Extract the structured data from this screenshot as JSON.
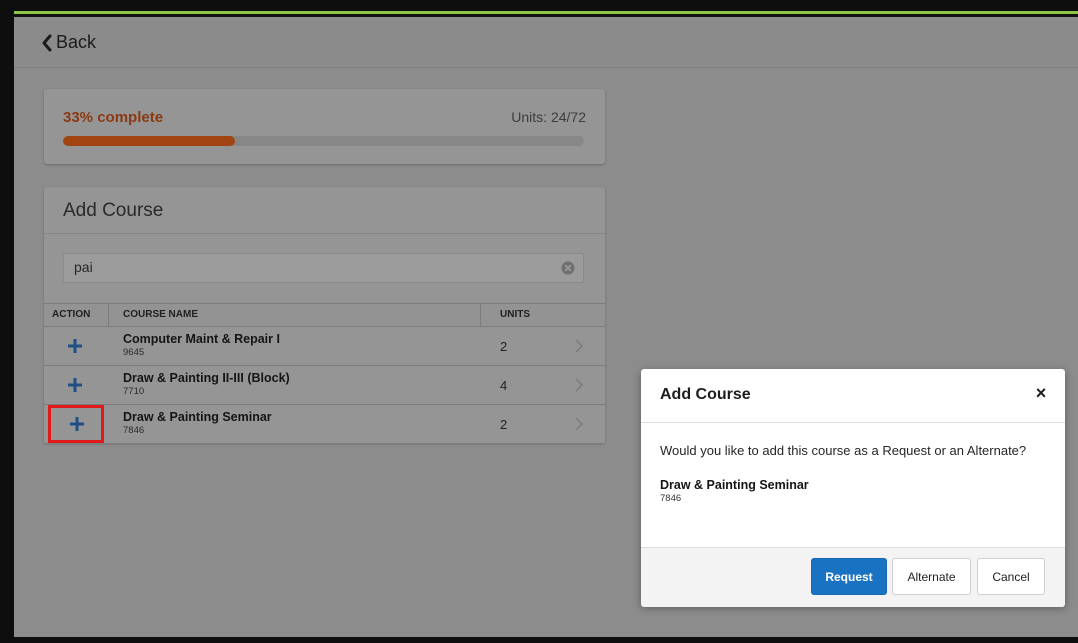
{
  "header": {
    "back_label": "Back"
  },
  "progress": {
    "percent_label": "33% complete",
    "units_label": "Units: 24/72",
    "fraction": 0.33
  },
  "add_course": {
    "title": "Add Course",
    "search_value": "pai",
    "columns": [
      "ACTION",
      "COURSE NAME",
      "UNITS"
    ],
    "rows": [
      {
        "name": "Computer Maint & Repair I",
        "code": "9645",
        "units": "2"
      },
      {
        "name": "Draw & Painting II-III (Block)",
        "code": "7710",
        "units": "4"
      },
      {
        "name": "Draw & Painting Seminar",
        "code": "7846",
        "units": "2"
      }
    ]
  },
  "modal": {
    "title": "Add Course",
    "close_glyph": "×",
    "question": "Would you like to add this course as a Request or an Alternate?",
    "course_name": "Draw & Painting Seminar",
    "course_code": "7846",
    "buttons": {
      "request": "Request",
      "alternate": "Alternate",
      "cancel": "Cancel"
    }
  },
  "colors": {
    "accent": "#1a72c3",
    "progress_fill": "#a14412",
    "highlight": "#e0191b"
  },
  "icons": {
    "back": "chevron-left-icon",
    "clear": "clear-circle-icon",
    "add": "plus-icon",
    "row_nav": "chevron-right-icon"
  }
}
